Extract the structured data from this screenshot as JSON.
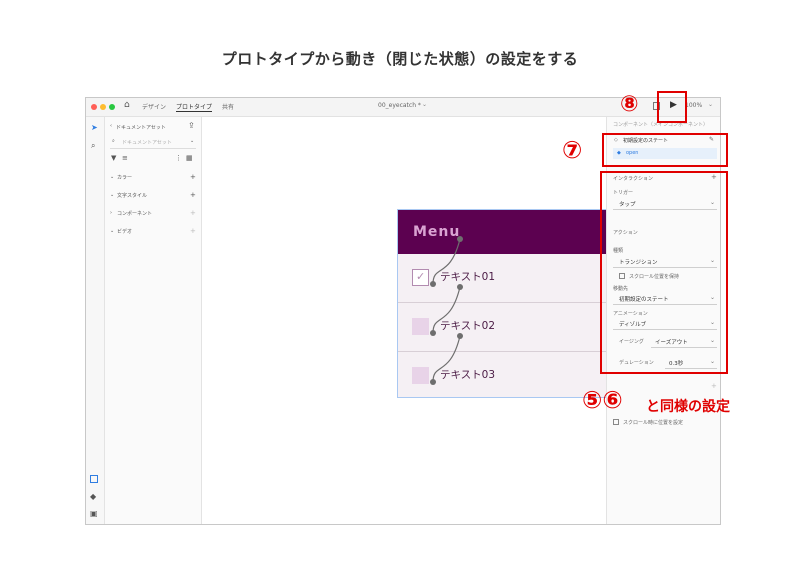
{
  "page_title": "プロトタイプから動き（閉じた状態）の設定をする",
  "titlebar": {
    "tabs": [
      "デザイン",
      "プロトタイプ",
      "共有"
    ],
    "active_tab": "プロトタイプ",
    "doc_name": "00_eyecatch * ",
    "zoom": "100%"
  },
  "left_panel": {
    "back_label": "ドキュメントアセット",
    "search_placeholder": "ドキュメントアセット",
    "sections": [
      "カラー",
      "文字スタイル",
      "コンポーネント",
      "ビデオ"
    ]
  },
  "menu_component": {
    "title": "Menu",
    "items": [
      {
        "label": "テキスト01",
        "checked": true
      },
      {
        "label": "テキスト02",
        "checked": false
      },
      {
        "label": "テキスト03",
        "checked": false
      }
    ]
  },
  "right_panel": {
    "component_header": "コンポーネント（メインコンポーネント）",
    "state_default": "初期設定のステート",
    "state_open": "open",
    "interaction_header": "インタラクション",
    "trigger_label": "トリガー",
    "trigger_value": "タップ",
    "action_header": "アクション",
    "type_label": "種類",
    "type_value": "トランジション",
    "preserve_scroll": "スクロール位置を保持",
    "destination_label": "移動先",
    "destination_value": "初期設定のステート",
    "animation_label": "アニメーション",
    "animation_value": "ディゾルブ",
    "easing_label": "イージング",
    "easing_value": "イーズアウト",
    "duration_label": "デュレーション",
    "duration_value": "0.3秒",
    "scroll_reset": "スクロール時に位置を設定"
  },
  "callouts": {
    "c8": "⑧",
    "c7": "⑦",
    "c56": "⑤⑥",
    "c56_text": "と同様の設定"
  },
  "colors": {
    "menu_header": "#5c0150",
    "menu_title": "#d9a3d2",
    "row_text": "#4a1a44",
    "callout_red": "#e00000",
    "wire_blue": "#2f7de1"
  }
}
